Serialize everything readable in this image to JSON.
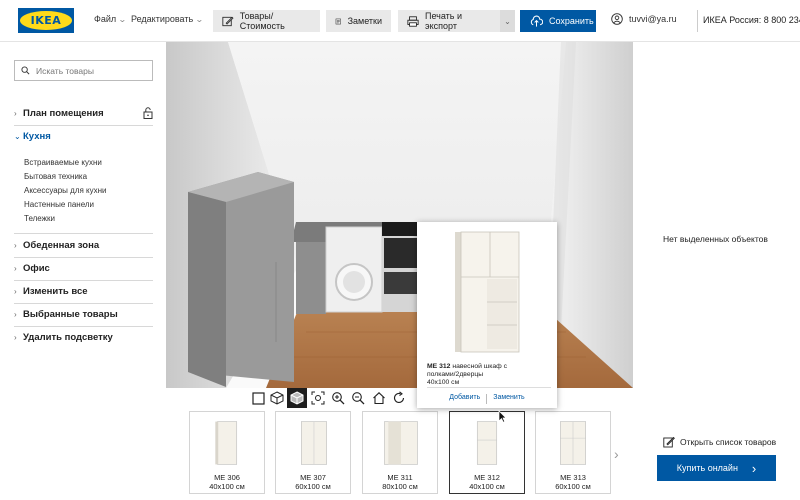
{
  "header": {
    "logo_text": "IKEA",
    "menu": [
      {
        "label": "Файл"
      },
      {
        "label": "Редактировать"
      }
    ],
    "buttons": {
      "products_cost": "Товары/Стоимость",
      "notes": "Заметки",
      "print_export": "Печать и экспорт",
      "save": "Сохранить"
    },
    "user_email": "tuvvi@ya.ru",
    "phone": "ИКЕА Россия: 8 800 234"
  },
  "sidebar": {
    "search_placeholder": "Искать товары",
    "sections": [
      {
        "label": "План помещения",
        "icon": "lock-icon"
      },
      {
        "label": "Кухня",
        "active": true
      }
    ],
    "kitchen_items": [
      "Встраиваемые кухни",
      "Бытовая техника",
      "Аксессуары для кухни",
      "Настенные панели",
      "Тележки"
    ],
    "more_sections": [
      "Обеденная зона",
      "Офис",
      "Изменить все",
      "Выбранные товары",
      "Удалить подсветку"
    ]
  },
  "popup": {
    "code": "ME 312",
    "description": "навесной шкаф с полками/2дверцы",
    "size": "40x100 см",
    "add": "Добавить",
    "replace": "Заменить"
  },
  "products": [
    {
      "code": "ME 306",
      "size": "40x100 см"
    },
    {
      "code": "ME 307",
      "size": "60x100 см"
    },
    {
      "code": "ME 311",
      "size": "80x100 см"
    },
    {
      "code": "ME 312",
      "size": "40x100 см",
      "selected": true
    },
    {
      "code": "ME 313",
      "size": "60x100 см"
    }
  ],
  "right_panel": {
    "no_selection": "Нет выделенных объектов",
    "open_list": "Открыть список товаров",
    "buy_online": "Купить онлайн"
  },
  "colors": {
    "brand_blue": "#0058a3",
    "brand_yellow": "#ffda1a"
  }
}
